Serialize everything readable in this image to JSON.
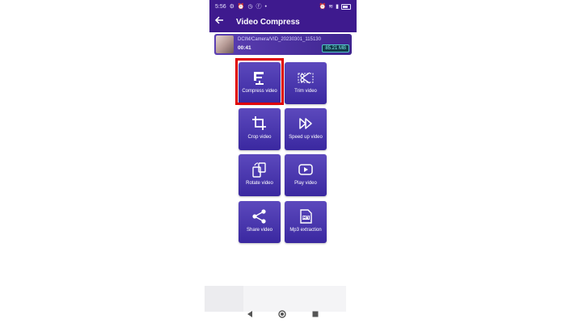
{
  "status_bar": {
    "time": "5:56",
    "icons": [
      "gear-icon",
      "alarm-icon",
      "clock-icon",
      "facebook-icon",
      "dot"
    ]
  },
  "app_bar": {
    "title": "Video Compress",
    "back_icon": "arrow-back-icon"
  },
  "file": {
    "path": "DCIM/Camera/VID_20230301_115130",
    "duration": "00:41",
    "size": "85.21 MB"
  },
  "menu": [
    {
      "label": "Compress video",
      "icon": "compress-icon"
    },
    {
      "label": "Trim video",
      "icon": "scissors-icon"
    },
    {
      "label": "Crop video",
      "icon": "crop-icon"
    },
    {
      "label": "Speed up video",
      "icon": "fast-forward-icon"
    },
    {
      "label": "Rotate video",
      "icon": "rotate-icon"
    },
    {
      "label": "Play video",
      "icon": "play-icon"
    },
    {
      "label": "Share video",
      "icon": "share-icon"
    },
    {
      "label": "Mp3 extraction",
      "icon": "mp3-icon"
    }
  ],
  "highlight": {
    "target": "Compress video",
    "color": "#e00000"
  },
  "colors": {
    "app_bar": "#3e1a8e",
    "tile": "#4b37ae",
    "size_text": "#7ef0f0"
  },
  "nav": [
    "back-triangle-icon",
    "home-circle-icon",
    "recents-square-icon"
  ]
}
